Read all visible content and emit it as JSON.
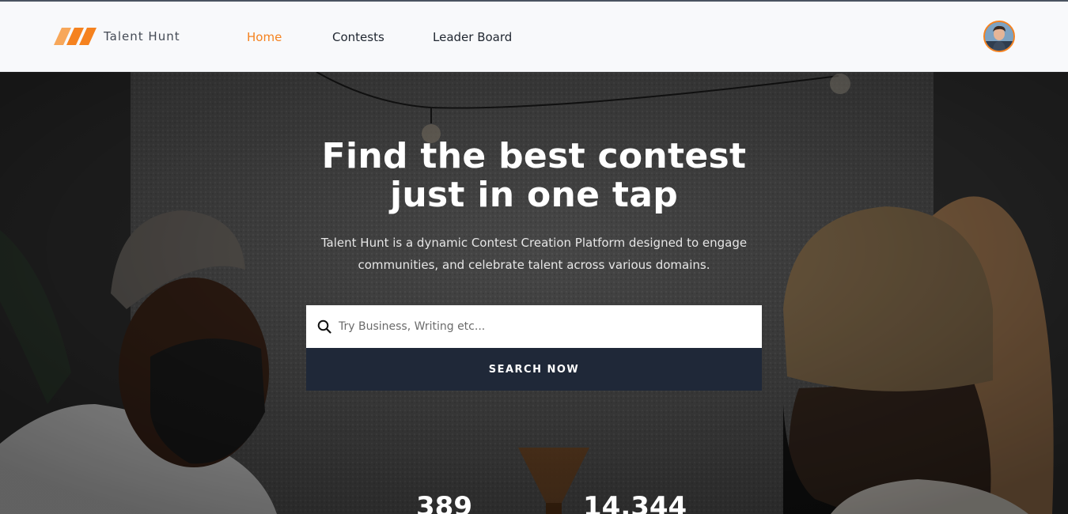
{
  "brand": {
    "name": "Talent Hunt",
    "accent_color": "#f5821f",
    "logo_icon": "slanted-stripes-logo"
  },
  "nav": {
    "items": [
      {
        "label": "Home",
        "active": true
      },
      {
        "label": "Contests",
        "active": false
      },
      {
        "label": "Leader Board",
        "active": false
      }
    ],
    "avatar_icon": "user-avatar"
  },
  "hero": {
    "title_line1": "Find the best contest",
    "title_line2": "just in one tap",
    "description_line1": "Talent Hunt is a dynamic Contest Creation Platform designed to engage",
    "description_line2": "communities, and celebrate talent across various domains.",
    "search": {
      "icon": "search-icon",
      "placeholder": "Try Business, Writing etc...",
      "value": "",
      "button_label": "SEARCH NOW"
    },
    "stats": [
      {
        "value": "389"
      },
      {
        "value": "14,344"
      }
    ]
  },
  "colors": {
    "nav_bg": "#f8f9fb",
    "button_bg": "#1f2838"
  }
}
